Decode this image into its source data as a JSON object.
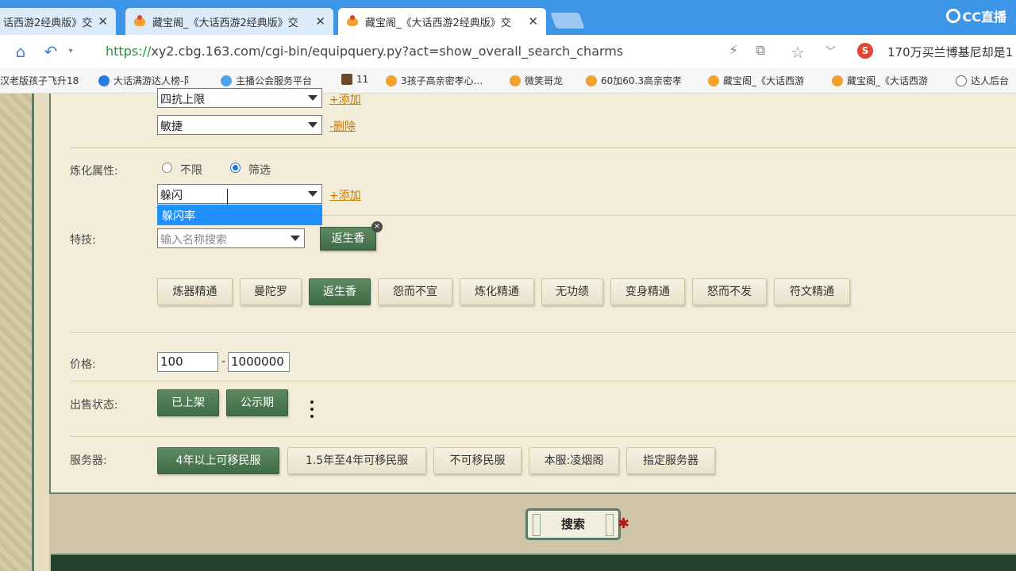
{
  "browser": {
    "tabs": [
      {
        "label": "话西游2经典版》交",
        "active": false
      },
      {
        "label": "藏宝阁_《大话西游2经典版》交",
        "active": false
      },
      {
        "label": "藏宝阁_《大话西游2经典版》交",
        "active": true
      }
    ],
    "tab_close": "✕",
    "brand": "CC直播",
    "url_scheme": "https://",
    "url_rest": "xy2.cbg.163.com/cgi-bin/equipquery.py?act=show_overall_search_charms",
    "news": "170万买兰博基尼却是1",
    "bookmarks": [
      "汉老版孩子飞升18",
      "大话满游达人榜-阝",
      "主播公会服务平台",
      "11",
      "3孩子高亲密孝心...",
      "微笑哥龙",
      "60加60.3高亲密孝",
      "藏宝阁_《大话西游",
      "藏宝阁_《大话西游",
      "达人后台"
    ]
  },
  "form": {
    "attr_rows": [
      {
        "value": "四抗上限",
        "action": "+添加"
      },
      {
        "value": "敏捷",
        "action": "-删除"
      }
    ],
    "refine": {
      "label": "炼化属性:",
      "radio_any": "不限",
      "radio_filter": "筛选",
      "input_value": "躲闪",
      "action": "+添加",
      "dropdown_option": "躲闪率"
    },
    "skill": {
      "label": "特技:",
      "placeholder": "输入名称搜索",
      "selected": "返生香",
      "remove": "×",
      "options": [
        "炼器精通",
        "曼陀罗",
        "返生香",
        "怨而不宣",
        "炼化精通",
        "无功绩",
        "变身精通",
        "怒而不发",
        "符文精通"
      ],
      "active_option": "返生香"
    },
    "price": {
      "label": "价格:",
      "min": "100",
      "separator": "-",
      "max": "1000000"
    },
    "sale_status": {
      "label": "出售状态:",
      "options": [
        "已上架",
        "公示期"
      ]
    },
    "server": {
      "label": "服务器:",
      "options": [
        "4年以上可移民服",
        "1.5年至4年可移民服",
        "不可移民服",
        "本服:凌烟阁",
        "指定服务器"
      ],
      "active_option": "4年以上可移民服"
    },
    "search_label": "搜索"
  },
  "colors": {
    "accent_green": "#4a7a50",
    "link_orange": "#c07a00",
    "highlight_blue": "#1e90ff",
    "browser_blue": "#3d95e8"
  }
}
